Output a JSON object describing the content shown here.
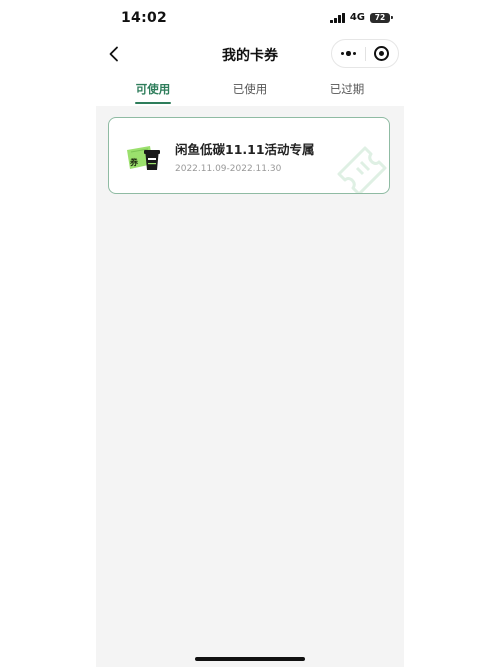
{
  "status_bar": {
    "time": "14:02",
    "network": "4G",
    "battery": "72"
  },
  "nav": {
    "title": "我的卡券",
    "back_icon": "chevron-left-icon",
    "more_icon": "more-dots-icon",
    "close_icon": "target-close-icon"
  },
  "tabs": [
    {
      "label": "可使用",
      "active": true
    },
    {
      "label": "已使用",
      "active": false
    },
    {
      "label": "已过期",
      "active": false
    }
  ],
  "coupons": [
    {
      "title": "闲鱼低碳11.11活动专属",
      "validity": "2022.11.09-2022.11.30",
      "badge": "券",
      "icon": "coupon-cup-icon"
    }
  ],
  "colors": {
    "accent": "#2e7d5b",
    "card_border": "#8fbba3",
    "content_bg": "#f4f4f4",
    "badge_green": "#9be06d"
  }
}
